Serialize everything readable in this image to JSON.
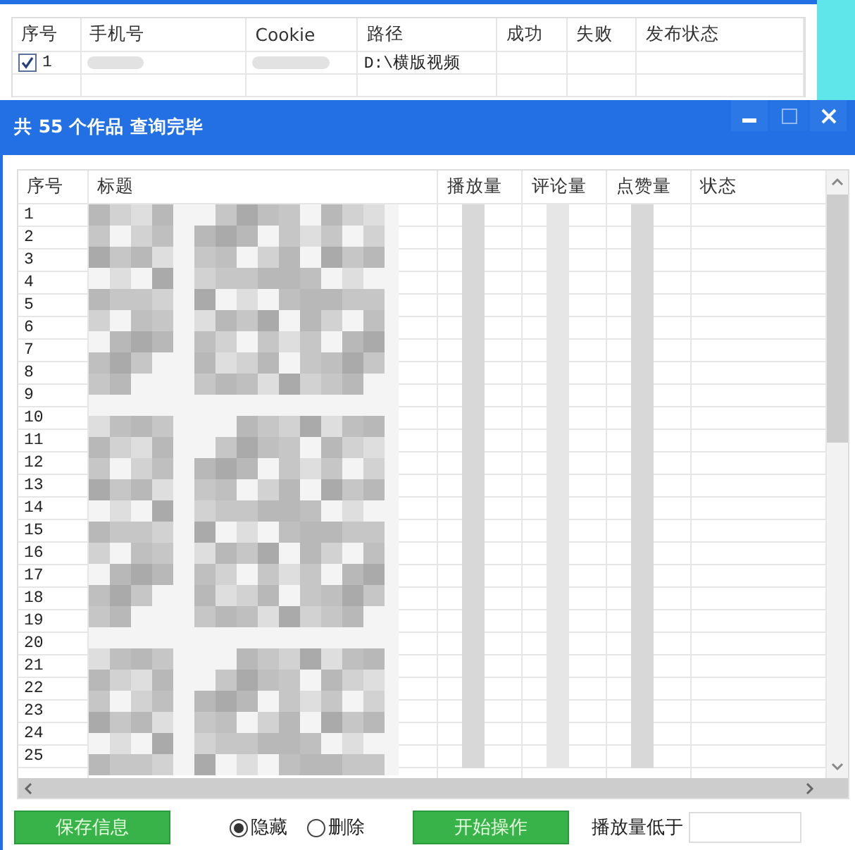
{
  "background_window": {
    "table": {
      "columns": [
        "序号",
        "手机号",
        "Cookie",
        "路径",
        "成功",
        "失败",
        "发布状态"
      ],
      "rows": [
        {
          "checked": true,
          "index": "1",
          "path": "D:\\横版视频"
        }
      ]
    }
  },
  "dialog": {
    "title": "共 55 个作品 查询完毕",
    "window_controls": [
      {
        "kind": "minimize",
        "disabled": false
      },
      {
        "kind": "maximize",
        "disabled": true
      },
      {
        "kind": "close",
        "disabled": false
      }
    ],
    "table": {
      "columns": [
        "序号",
        "标题",
        "播放量",
        "评论量",
        "点赞量",
        "状态"
      ],
      "rows": [
        {
          "index": "1"
        },
        {
          "index": "2"
        },
        {
          "index": "3"
        },
        {
          "index": "4"
        },
        {
          "index": "5"
        },
        {
          "index": "6"
        },
        {
          "index": "7"
        },
        {
          "index": "8"
        },
        {
          "index": "9"
        },
        {
          "index": "10"
        },
        {
          "index": "11"
        },
        {
          "index": "12"
        },
        {
          "index": "13"
        },
        {
          "index": "14"
        },
        {
          "index": "15"
        },
        {
          "index": "16"
        },
        {
          "index": "17"
        },
        {
          "index": "18"
        },
        {
          "index": "19"
        },
        {
          "index": "20"
        },
        {
          "index": "21"
        },
        {
          "index": "22"
        },
        {
          "index": "23"
        },
        {
          "index": "24"
        },
        {
          "index": "25"
        }
      ]
    },
    "save_button": "保存信息",
    "options": [
      {
        "label": "隐藏",
        "selected": true
      },
      {
        "label": "删除",
        "selected": false
      }
    ],
    "start_button": "开始操作",
    "filter": {
      "label": "播放量低于"
    }
  }
}
